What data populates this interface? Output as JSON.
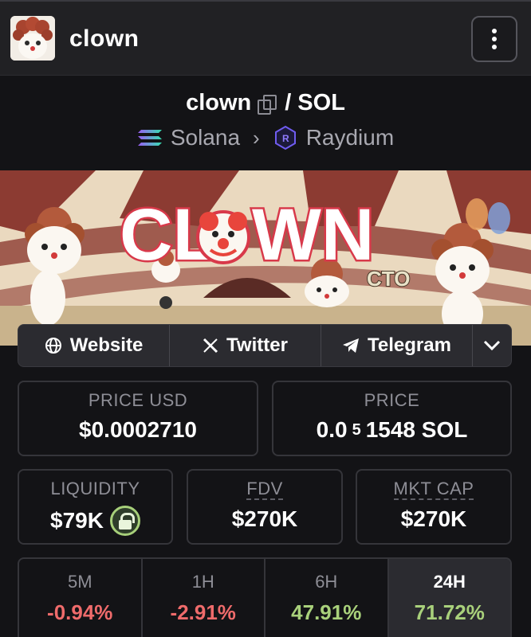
{
  "header": {
    "token_name": "clown"
  },
  "pair": {
    "base": "clown",
    "separator": "/",
    "quote": "SOL",
    "chain": "Solana",
    "dex": "Raydium"
  },
  "banner": {
    "logo_text": "CL WN",
    "tag": "CTO"
  },
  "links": {
    "website": "Website",
    "twitter": "Twitter",
    "telegram": "Telegram"
  },
  "stats": {
    "price_usd_label": "PRICE USD",
    "price_usd_value": "$0.0002710",
    "price_label": "PRICE",
    "price_value_prefix": "0.0",
    "price_value_sub": "5",
    "price_value_suffix": "1548 SOL",
    "liquidity_label": "LIQUIDITY",
    "liquidity_value": "$79K",
    "fdv_label": "FDV",
    "fdv_value": "$270K",
    "mktcap_label": "MKT CAP",
    "mktcap_value": "$270K"
  },
  "timeframes": [
    {
      "label": "5M",
      "value": "-0.94%",
      "color": "#ef6b6b"
    },
    {
      "label": "1H",
      "value": "-2.91%",
      "color": "#ef6b6b"
    },
    {
      "label": "6H",
      "value": "47.91%",
      "color": "#a9d17b"
    },
    {
      "label": "24H",
      "value": "71.72%",
      "color": "#a9d17b"
    }
  ],
  "colors": {
    "negative": "#ef6b6b",
    "positive": "#a9d17b",
    "background": "#131316"
  }
}
